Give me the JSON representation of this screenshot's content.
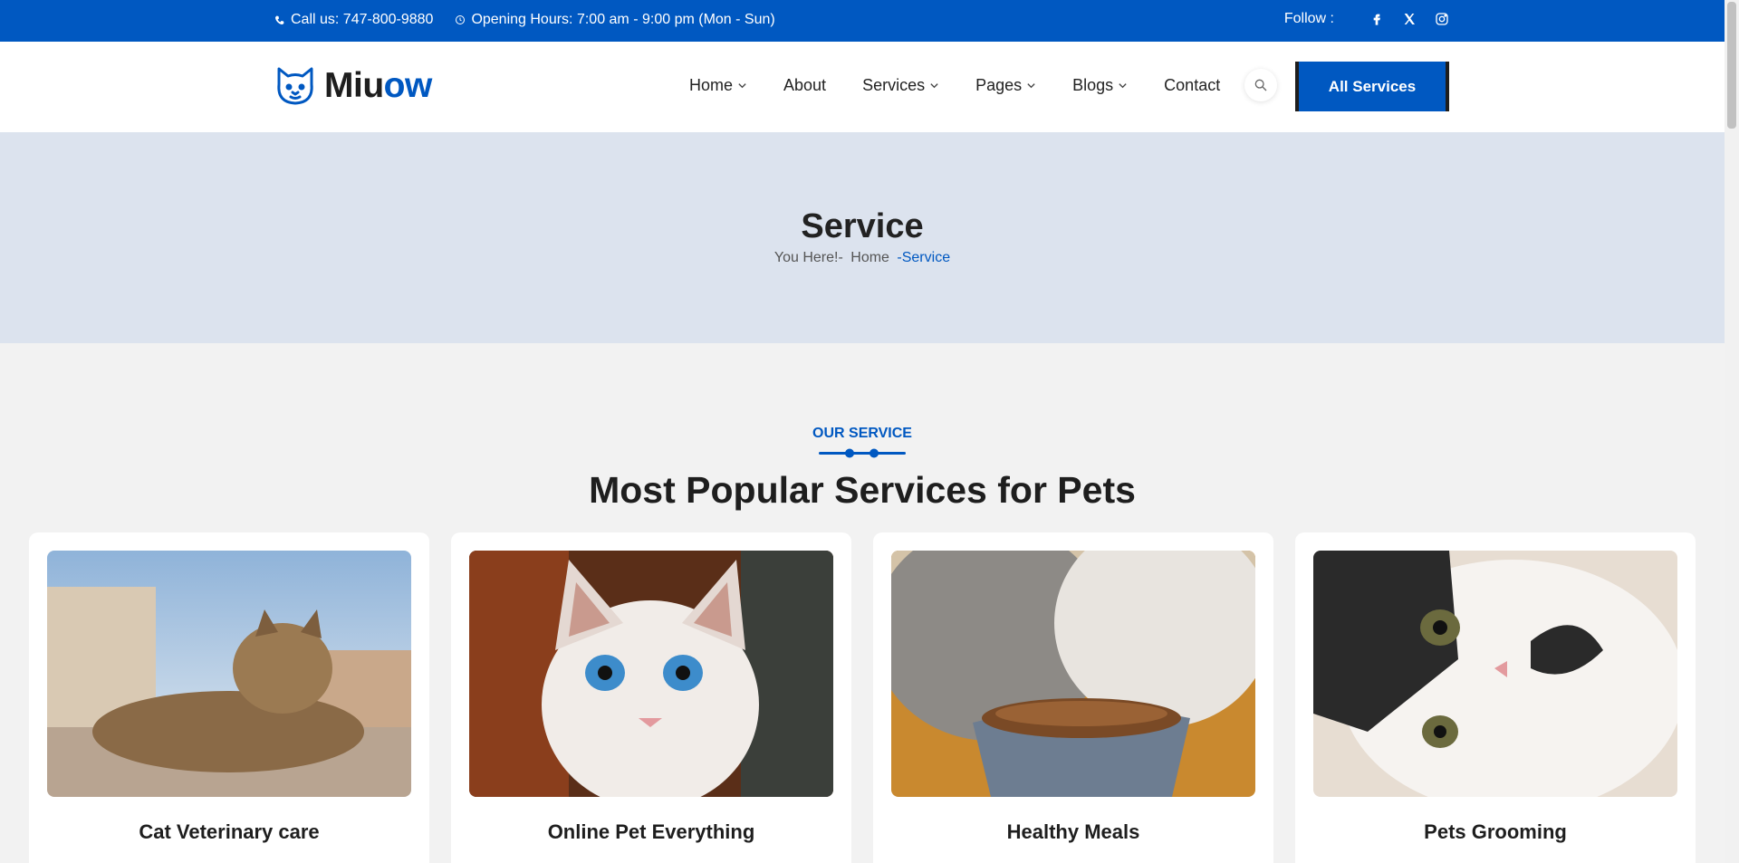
{
  "topbar": {
    "call": "Call us: 747-800-9880",
    "hours": "Opening Hours: 7:00 am - 9:00 pm (Mon - Sun)",
    "follow": "Follow :",
    "socials": [
      "facebook-icon",
      "x-icon",
      "instagram-icon"
    ]
  },
  "header": {
    "logo_a": "Miu",
    "logo_b": "ow",
    "nav": [
      {
        "label": "Home",
        "dropdown": true
      },
      {
        "label": "About",
        "dropdown": false
      },
      {
        "label": "Services",
        "dropdown": true
      },
      {
        "label": "Pages",
        "dropdown": true
      },
      {
        "label": "Blogs",
        "dropdown": true
      },
      {
        "label": "Contact",
        "dropdown": false
      }
    ],
    "cta": "All Services"
  },
  "banner": {
    "title": "Service",
    "crumb_prefix": "You Here!-",
    "crumb_home": "Home",
    "crumb_current": "-Service"
  },
  "section": {
    "subtitle": "OUR SERVICE",
    "title": "Most Popular Services for Pets"
  },
  "cards": [
    {
      "title": "Cat Veterinary care"
    },
    {
      "title": "Online Pet Everything"
    },
    {
      "title": "Healthy Meals"
    },
    {
      "title": "Pets Grooming"
    }
  ],
  "colors": {
    "accent": "#0058c1",
    "banner": "#dce3ee",
    "page": "#f2f2f2"
  }
}
